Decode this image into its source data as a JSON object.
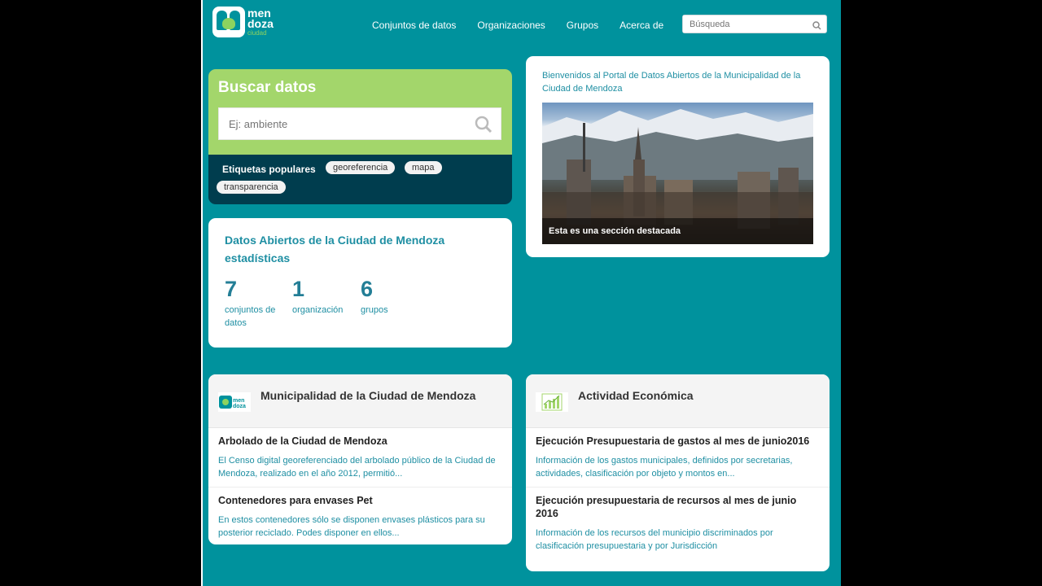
{
  "header": {
    "logo_line1": "men",
    "logo_line2": "doza",
    "logo_sub": "ciudad",
    "nav": [
      "Conjuntos de datos",
      "Organizaciones",
      "Grupos",
      "Acerca de"
    ],
    "search_placeholder": "Búsqueda"
  },
  "search": {
    "title": "Buscar datos",
    "placeholder": "Ej: ambiente",
    "tags_label": "Etiquetas populares",
    "tags": [
      "georeferencia",
      "mapa",
      "transparencia"
    ]
  },
  "stats": {
    "title": "Datos Abiertos de la Ciudad de Mendoza estadísticas",
    "items": [
      {
        "num": "7",
        "label": "conjuntos de datos"
      },
      {
        "num": "1",
        "label": "organización"
      },
      {
        "num": "6",
        "label": "grupos"
      }
    ]
  },
  "featured": {
    "intro": "Bienvenidos al Portal de Datos Abiertos de la Municipalidad de la Ciudad de Mendoza",
    "caption": "Esta es una sección destacada"
  },
  "org_card": {
    "title": "Municipalidad de la Ciudad de Mendoza",
    "items": [
      {
        "title": "Arbolado de la Ciudad de Mendoza",
        "desc": "El Censo digital georeferenciado del arbolado público de la Ciudad de Mendoza, realizado en el año 2012, permitió..."
      },
      {
        "title": "Contenedores para envases Pet",
        "desc": "En estos contenedores sólo se disponen envases plásticos para su posterior reciclado. Podes disponer en ellos..."
      }
    ]
  },
  "group_card": {
    "title": "Actividad Económica",
    "items": [
      {
        "title": "Ejecución Presupuestaria de gastos al mes de junio2016",
        "desc": "Información de los gastos municipales, definidos por secretarias, actividades, clasificación por objeto y montos en..."
      },
      {
        "title": "Ejecución presupuestaria de recursos al mes de junio 2016",
        "desc": "Información de los recursos del municipio discriminados por clasificación presupuestaria y por Jurisdicción"
      }
    ]
  },
  "colors": {
    "teal": "#00929d",
    "green": "#a3d66b",
    "dark": "#003d4e"
  }
}
